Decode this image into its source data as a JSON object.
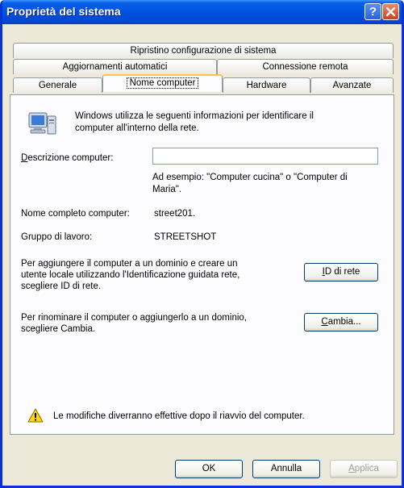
{
  "window": {
    "title": "Proprietà del sistema",
    "help_glyph": "?"
  },
  "tabs": {
    "row1": [
      "Ripristino configurazione di sistema"
    ],
    "row2": [
      "Aggiornamenti automatici",
      "Connessione remota"
    ],
    "row3": [
      "Generale",
      "Nome computer",
      "Hardware",
      "Avanzate"
    ],
    "active": "Nome computer"
  },
  "panel": {
    "intro": [
      "Windows utilizza le seguenti informazioni per identificare il",
      "computer all'interno della rete."
    ],
    "description_label_ul": "D",
    "description_label_rest": "escrizione computer:",
    "description_value": "",
    "example": [
      "Ad esempio: \"Computer cucina\" o \"Computer di",
      "Maria\"."
    ],
    "fullname_label": "Nome completo computer:",
    "fullname_value": "street201.",
    "workgroup_label": "Gruppo di lavoro:",
    "workgroup_value": "STREETSHOT",
    "domain_text": [
      "Per aggiungere il computer a un dominio e creare un",
      "utente locale utilizzando l'Identificazione guidata rete,",
      "scegliere ID di rete."
    ],
    "network_id_button_ul": "I",
    "network_id_button_rest": "D di rete",
    "rename_text": [
      "Per rinominare il computer o aggiungerlo a un dominio,",
      "scegliere Cambia."
    ],
    "change_button_ul": "C",
    "change_button_rest": "ambia...",
    "warning": "Le modifiche diverranno effettive dopo il riavvio del computer."
  },
  "footer": {
    "ok_label": "OK",
    "cancel_label": "Annulla",
    "apply_ul": "A",
    "apply_rest": "pplica",
    "apply_enabled": false
  },
  "icons": {
    "computer": "computer-icon",
    "warning": "warning-icon",
    "help": "help-icon",
    "close": "close-icon"
  }
}
